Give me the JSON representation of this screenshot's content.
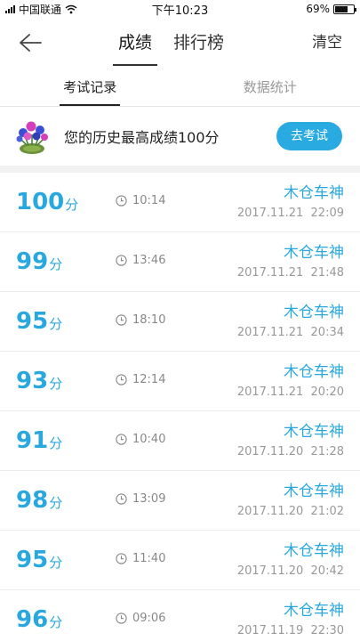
{
  "status_bar": {
    "carrier": "中国联通",
    "time": "下午10:23",
    "battery": "69%",
    "battery_level": 0.69
  },
  "nav": {
    "tabs": [
      "成绩",
      "排行榜"
    ],
    "active_tab": 0,
    "clear_label": "清空"
  },
  "sub_tabs": {
    "items": [
      "考试记录",
      "数据统计"
    ],
    "active": 0
  },
  "best": {
    "text": "您的历史最高成绩100分",
    "button_label": "去考试"
  },
  "records": [
    {
      "score": "100",
      "unit": "分",
      "duration": "10:14",
      "user": "木仓车神",
      "date": "2017.11.21",
      "time": "22:09"
    },
    {
      "score": "99",
      "unit": "分",
      "duration": "13:46",
      "user": "木仓车神",
      "date": "2017.11.21",
      "time": "21:48"
    },
    {
      "score": "95",
      "unit": "分",
      "duration": "18:10",
      "user": "木仓车神",
      "date": "2017.11.21",
      "time": "20:34"
    },
    {
      "score": "93",
      "unit": "分",
      "duration": "12:14",
      "user": "木仓车神",
      "date": "2017.11.21",
      "time": "20:20"
    },
    {
      "score": "91",
      "unit": "分",
      "duration": "10:40",
      "user": "木仓车神",
      "date": "2017.11.20",
      "time": "21:28"
    },
    {
      "score": "98",
      "unit": "分",
      "duration": "13:09",
      "user": "木仓车神",
      "date": "2017.11.20",
      "time": "21:02"
    },
    {
      "score": "95",
      "unit": "分",
      "duration": "11:40",
      "user": "木仓车神",
      "date": "2017.11.20",
      "time": "20:42"
    },
    {
      "score": "96",
      "unit": "分",
      "duration": "09:06",
      "user": "木仓车神",
      "date": "2017.11.19",
      "time": "22:30"
    }
  ],
  "colors": {
    "accent": "#29a8e0",
    "button": "#29abe2"
  },
  "icons": {
    "back": "back-arrow-icon",
    "clock": "clock-icon",
    "flower": "flower-pot-icon"
  }
}
